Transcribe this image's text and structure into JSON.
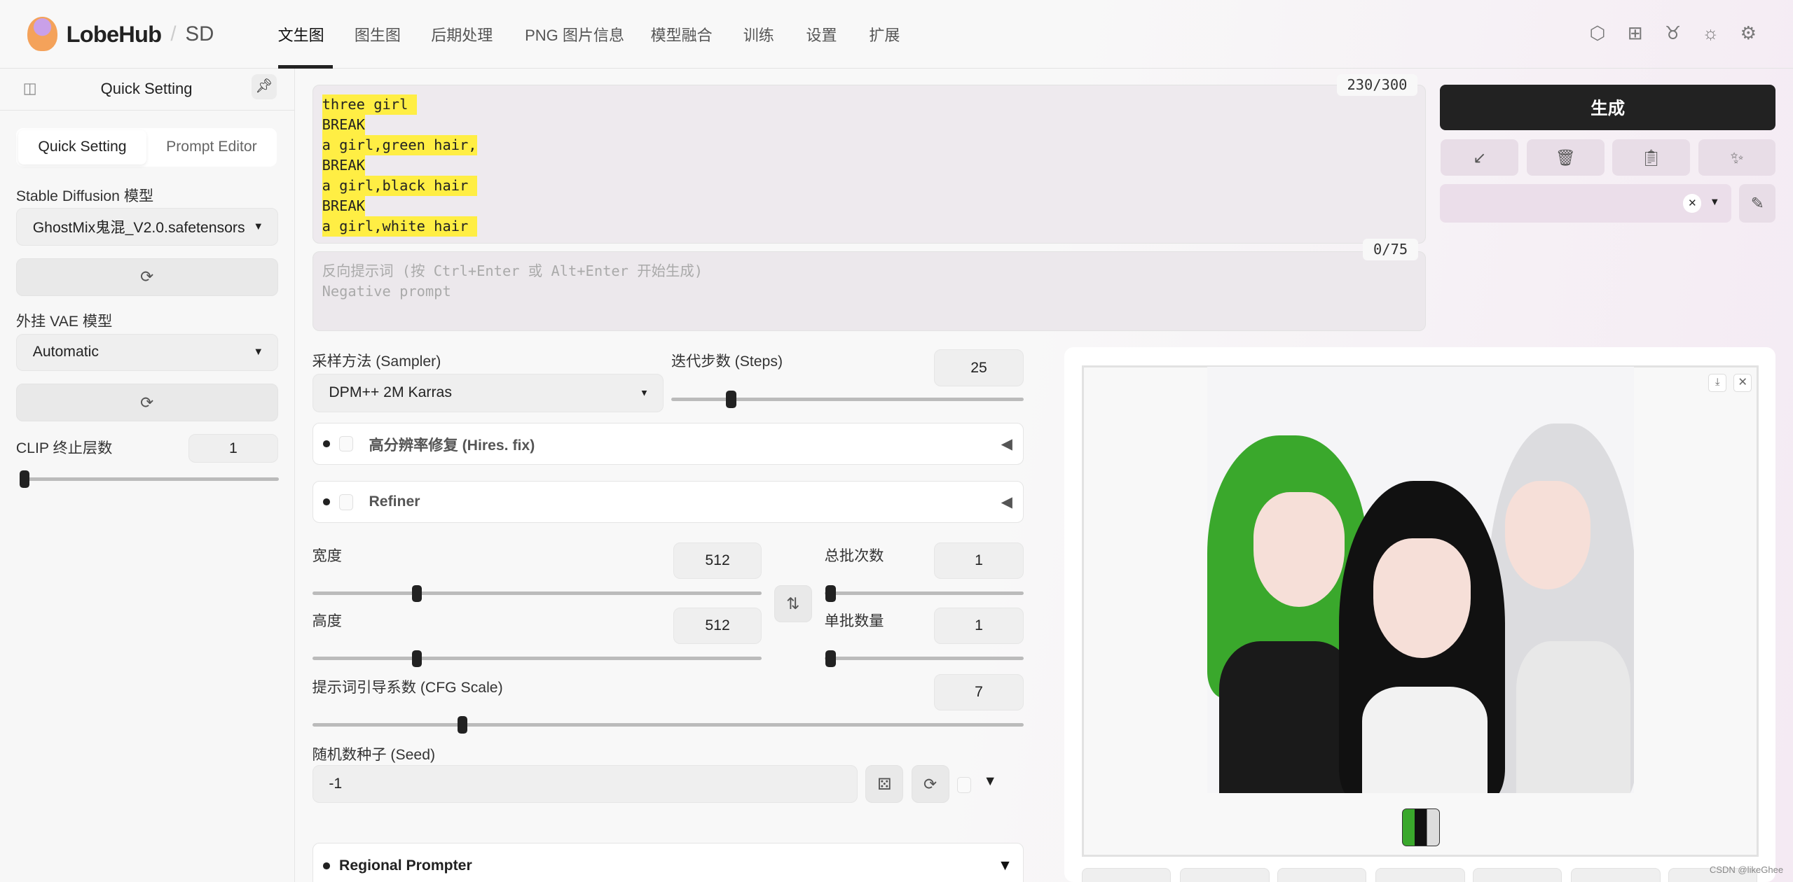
{
  "header": {
    "brand": "LobeHub",
    "separator": "/",
    "product": "SD",
    "nav": [
      {
        "label": "文生图",
        "active": true
      },
      {
        "label": "图生图"
      },
      {
        "label": "后期处理"
      },
      {
        "label": "PNG 图片信息"
      },
      {
        "label": "模型融合"
      },
      {
        "label": "训练"
      },
      {
        "label": "设置"
      },
      {
        "label": "扩展"
      }
    ],
    "icons": [
      "civitai-icon",
      "grid-icon",
      "github-icon",
      "sun-icon",
      "gear-icon"
    ]
  },
  "sidebar": {
    "title": "Quick Setting",
    "tabs": [
      "Quick Setting",
      "Prompt Editor"
    ],
    "sd_model_label": "Stable Diffusion 模型",
    "sd_model_value": "GhostMix鬼混_V2.0.safetensors",
    "vae_label": "外挂 VAE 模型",
    "vae_value": "Automatic",
    "clip_label": "CLIP 终止层数",
    "clip_value": "1",
    "clip_fraction": 0
  },
  "prompt": {
    "lines": [
      "three girl ",
      "BREAK",
      "a girl,green hair,",
      "BREAK",
      "a girl,black hair ",
      "BREAK",
      "a girl,white hair "
    ],
    "count": "230/300"
  },
  "negative": {
    "placeholder_line1": "反向提示词 (按 Ctrl+Enter 或 Alt+Enter 开始生成)",
    "placeholder_line2": "Negative prompt",
    "count": "0/75"
  },
  "actions": {
    "generate": "生成",
    "style_clear": "×"
  },
  "settings": {
    "sampler_label": "采样方法 (Sampler)",
    "sampler_value": "DPM++ 2M Karras",
    "steps_label": "迭代步数 (Steps)",
    "steps_value": "25",
    "hires_label": "高分辨率修复 (Hires. fix)",
    "refiner_label": "Refiner",
    "width_label": "宽度",
    "width_value": "512",
    "height_label": "高度",
    "height_value": "512",
    "batch_count_label": "总批次数",
    "batch_count_value": "1",
    "batch_size_label": "单批数量",
    "batch_size_value": "1",
    "cfg_label": "提示词引导系数 (CFG Scale)",
    "cfg_value": "7",
    "seed_label": "随机数种子 (Seed)",
    "seed_value": "-1",
    "regional_label": "Regional Prompter"
  },
  "watermark": "CSDN @likeGhee"
}
